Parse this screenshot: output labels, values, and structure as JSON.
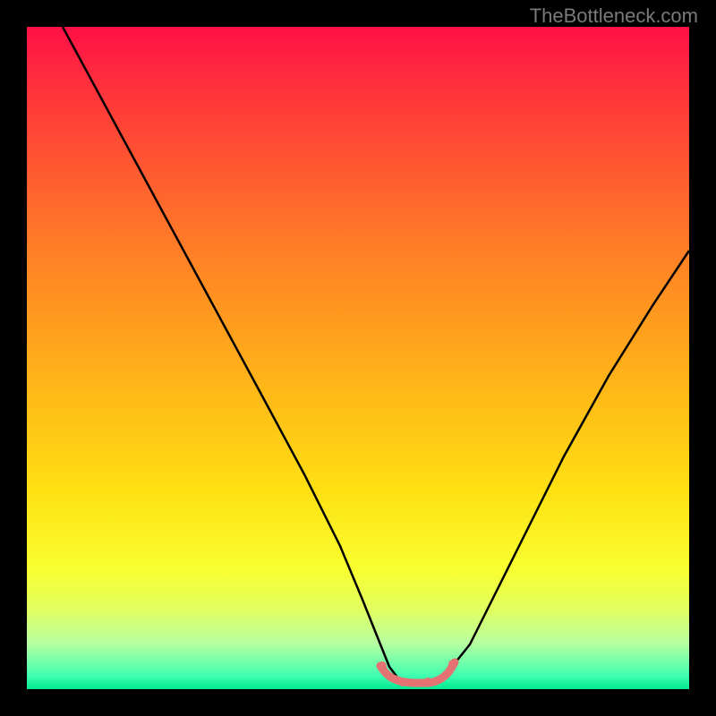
{
  "watermark": "TheBottleneck.com",
  "chart_data": {
    "type": "line",
    "title": "",
    "xlabel": "",
    "ylabel": "",
    "x": [
      0,
      5,
      10,
      15,
      20,
      25,
      30,
      35,
      40,
      45,
      50,
      52,
      55,
      58,
      60,
      65,
      70,
      75,
      80,
      85,
      90,
      95,
      100
    ],
    "values": [
      100,
      90,
      80,
      70,
      60,
      50,
      40,
      30,
      20,
      10,
      3,
      1,
      0,
      0,
      1,
      5,
      12,
      22,
      32,
      42,
      50,
      57,
      62
    ],
    "xlim": [
      0,
      100
    ],
    "ylim": [
      0,
      100
    ],
    "gradient_background": {
      "stops": [
        {
          "pos": 0.0,
          "color": "#ff1046"
        },
        {
          "pos": 0.15,
          "color": "#ff4436"
        },
        {
          "pos": 0.38,
          "color": "#ff8a22"
        },
        {
          "pos": 0.7,
          "color": "#ffe012"
        },
        {
          "pos": 0.88,
          "color": "#e0ff60"
        },
        {
          "pos": 1.0,
          "color": "#00e890"
        }
      ]
    },
    "highlight": {
      "color": "#e57373",
      "x_range": [
        49,
        61
      ],
      "y": 0
    }
  }
}
